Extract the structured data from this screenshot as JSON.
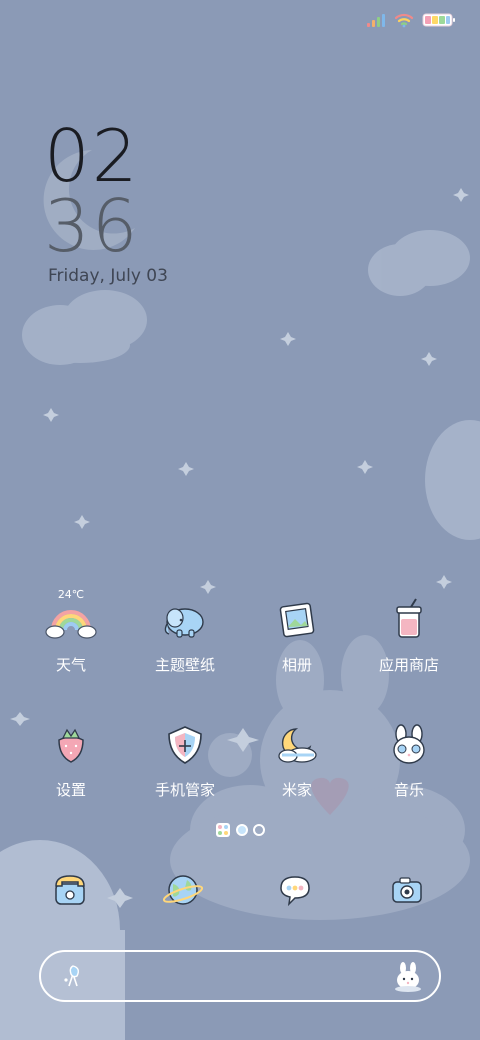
{
  "status": {
    "signal_icon": "signal-bars-icon",
    "wifi_icon": "wifi-icon",
    "battery_icon": "battery-icon",
    "battery_colors": [
      "#f5a0b5",
      "#ffd966",
      "#9ed99a",
      "#9ecbf2"
    ]
  },
  "clock": {
    "hour": "02",
    "minute": "36",
    "date": "Friday, July 03"
  },
  "weather": {
    "temperature": "24℃"
  },
  "apps": {
    "weather": "天气",
    "themes": "主题壁纸",
    "gallery": "相册",
    "app_store": "应用商店",
    "settings": "设置",
    "security": "手机管家",
    "mi_home": "米家",
    "music": "音乐"
  },
  "pager": {
    "page_count": 3,
    "current_page": 2
  },
  "dock": {
    "icons": [
      "phone-icon",
      "browser-globe-icon",
      "messages-bubble-icon",
      "camera-icon"
    ]
  },
  "search": {
    "left_icon": "voice-assistant-icon",
    "right_icon": "bunny-assistant-icon"
  },
  "colors": {
    "background": "#8b9ab6",
    "accent_blue": "#a8d4f5",
    "accent_pink": "#f4b6c2"
  }
}
